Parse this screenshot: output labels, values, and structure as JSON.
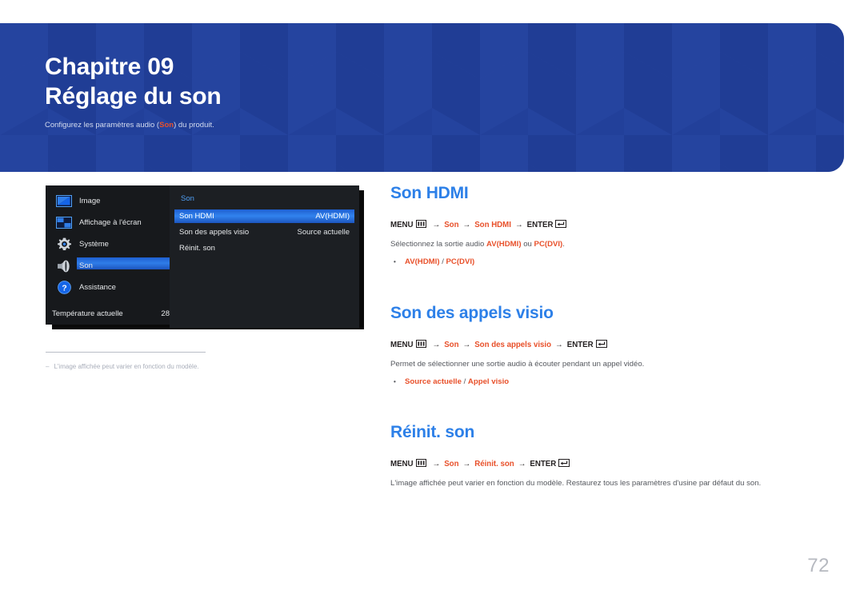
{
  "banner": {
    "chapter_number": "Chapitre 09",
    "chapter_title": "Réglage du son",
    "subtitle_before": "Configurez les paramètres audio (",
    "subtitle_keyword": "Son",
    "subtitle_after": ") du produit.",
    "bg_color": "#22409A",
    "title_color": "#FFFFFF",
    "keyword_color": "#E8502A"
  },
  "osd": {
    "sidebar": [
      {
        "label": "Image",
        "icon": "picture-icon",
        "selected": false
      },
      {
        "label": "Affichage à l'écran",
        "icon": "osd-grid-icon",
        "selected": false
      },
      {
        "label": "Système",
        "icon": "gear-icon",
        "selected": false
      },
      {
        "label": "Son",
        "icon": "speaker-icon",
        "selected": true
      },
      {
        "label": "Assistance",
        "icon": "question-circle-icon",
        "selected": false
      }
    ],
    "temperature_label": "Température actuelle",
    "temperature_value": "28",
    "submenu_title": "Son",
    "submenu_rows": [
      {
        "label": "Son HDMI",
        "value": "AV(HDMI)",
        "selected": true
      },
      {
        "label": "Son des appels visio",
        "value": "Source actuelle",
        "selected": false
      },
      {
        "label": "Réinit. son",
        "value": "",
        "selected": false
      }
    ],
    "highlight_color": "#2F7DE8",
    "panel_bg": "#17191C",
    "submenu_bg": "#1C1F23",
    "title_color": "#4F9FF5"
  },
  "footnote": {
    "dash": "‒",
    "text": "L'image affichée peut varier en fonction du modèle."
  },
  "sections": [
    {
      "heading": "Son HDMI",
      "path": {
        "menu": "MENU",
        "menu_icon": "menu-bars-icon",
        "step1": "Son",
        "step2": "Son HDMI",
        "enter": "ENTER",
        "enter_icon": "enter-return-icon",
        "arrow": "→"
      },
      "description_parts": [
        {
          "text": "Sélectionnez la sortie audio ",
          "red": false
        },
        {
          "text": "AV(HDMI)",
          "red": true
        },
        {
          "text": " ou ",
          "red": false
        },
        {
          "text": "PC(DVI)",
          "red": true
        },
        {
          "text": ".",
          "red": false
        }
      ],
      "bullet": "AV(HDMI) / PC(DVI)",
      "bullet_options": [
        "AV(HDMI)",
        "PC(DVI)"
      ]
    },
    {
      "heading": "Son des appels visio",
      "path": {
        "menu": "MENU",
        "menu_icon": "menu-bars-icon",
        "step1": "Son",
        "step2": "Son des appels visio",
        "enter": "ENTER",
        "enter_icon": "enter-return-icon",
        "arrow": "→"
      },
      "description_parts": [
        {
          "text": "Permet de sélectionner une sortie audio à écouter pendant un appel vidéo.",
          "red": false
        }
      ],
      "bullet": "Source actuelle / Appel visio",
      "bullet_options": [
        "Source actuelle",
        "Appel visio"
      ]
    },
    {
      "heading": "Réinit. son",
      "path": {
        "menu": "MENU",
        "menu_icon": "menu-bars-icon",
        "step1": "Son",
        "step2": "Réinit. son",
        "enter": "ENTER",
        "enter_icon": "enter-return-icon",
        "arrow": "→"
      },
      "description_parts": [
        {
          "text": "L'image affichée peut varier en fonction du modèle. Restaurez tous les paramètres d'usine par défaut du son.",
          "red": false
        }
      ],
      "bullet": "",
      "bullet_options": []
    }
  ],
  "page_number": "72",
  "colors": {
    "heading_blue": "#2D80E8",
    "accent_red": "#E8502A",
    "body_gray": "#55585E",
    "page_number_gray": "#B6B9C0"
  }
}
